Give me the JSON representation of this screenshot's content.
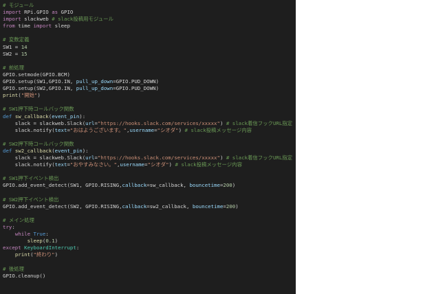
{
  "editor": {
    "background": "#1e1e1e",
    "language": "python",
    "lines": [
      [
        {
          "t": "# モジュール",
          "k": "cmt"
        }
      ],
      [
        {
          "t": "import",
          "k": "kw"
        },
        {
          "t": " RPi.GPIO ",
          "k": "txt"
        },
        {
          "t": "as",
          "k": "kw"
        },
        {
          "t": " GPIO",
          "k": "txt"
        }
      ],
      [
        {
          "t": "import",
          "k": "kw"
        },
        {
          "t": " slackweb ",
          "k": "txt"
        },
        {
          "t": "# slack投稿用モジュール",
          "k": "cmt"
        }
      ],
      [
        {
          "t": "from",
          "k": "kw"
        },
        {
          "t": " time ",
          "k": "txt"
        },
        {
          "t": "import",
          "k": "kw"
        },
        {
          "t": " sleep",
          "k": "txt"
        }
      ],
      [],
      [
        {
          "t": "# 変数定義",
          "k": "cmt"
        }
      ],
      [
        {
          "t": "SW1 = ",
          "k": "txt"
        },
        {
          "t": "14",
          "k": "num"
        }
      ],
      [
        {
          "t": "SW2 = ",
          "k": "txt"
        },
        {
          "t": "15",
          "k": "num"
        }
      ],
      [],
      [
        {
          "t": "# 前処理",
          "k": "cmt"
        }
      ],
      [
        {
          "t": "GPIO.setmode(GPIO.BCM)",
          "k": "txt"
        }
      ],
      [
        {
          "t": "GPIO.setup(SW1,GPIO.IN, ",
          "k": "txt"
        },
        {
          "t": "pull_up_down",
          "k": "var"
        },
        {
          "t": "=GPIO.PUD_DOWN)",
          "k": "txt"
        }
      ],
      [
        {
          "t": "GPIO.setup(SW2,GPIO.IN, ",
          "k": "txt"
        },
        {
          "t": "pull_up_down",
          "k": "var"
        },
        {
          "t": "=GPIO.PUD_DOWN)",
          "k": "txt"
        }
      ],
      [
        {
          "t": "print",
          "k": "fn"
        },
        {
          "t": "(",
          "k": "txt"
        },
        {
          "t": "\"開始\"",
          "k": "str"
        },
        {
          "t": ")",
          "k": "txt"
        }
      ],
      [],
      [
        {
          "t": "# SW1押下時コールバック関数",
          "k": "cmt"
        }
      ],
      [
        {
          "t": "def",
          "k": "def"
        },
        {
          "t": " ",
          "k": "txt"
        },
        {
          "t": "sw_callback",
          "k": "fn"
        },
        {
          "t": "(",
          "k": "txt"
        },
        {
          "t": "event_pin",
          "k": "var"
        },
        {
          "t": "):",
          "k": "txt"
        }
      ],
      [
        {
          "t": "    slack = slackweb.Slack(",
          "k": "txt"
        },
        {
          "t": "url",
          "k": "var"
        },
        {
          "t": "=",
          "k": "txt"
        },
        {
          "t": "\"https://hooks.slack.com/services/xxxxx\"",
          "k": "str"
        },
        {
          "t": ") ",
          "k": "txt"
        },
        {
          "t": "# slack着信フックURL指定",
          "k": "cmt"
        }
      ],
      [
        {
          "t": "    slack.notify(",
          "k": "txt"
        },
        {
          "t": "text",
          "k": "var"
        },
        {
          "t": "=",
          "k": "txt"
        },
        {
          "t": "\"おはようございます。\"",
          "k": "str"
        },
        {
          "t": ",",
          "k": "txt"
        },
        {
          "t": "username",
          "k": "var"
        },
        {
          "t": "=",
          "k": "txt"
        },
        {
          "t": "\"シオダ\"",
          "k": "str"
        },
        {
          "t": ") ",
          "k": "txt"
        },
        {
          "t": "# slack投稿メッセージ内容",
          "k": "cmt"
        }
      ],
      [],
      [
        {
          "t": "# SW2押下時コールバック関数",
          "k": "cmt"
        }
      ],
      [
        {
          "t": "def",
          "k": "def"
        },
        {
          "t": " ",
          "k": "txt"
        },
        {
          "t": "sw2_callback",
          "k": "fn"
        },
        {
          "t": "(",
          "k": "txt"
        },
        {
          "t": "event_pin",
          "k": "var"
        },
        {
          "t": "):",
          "k": "txt"
        }
      ],
      [
        {
          "t": "    slack = slackweb.Slack(",
          "k": "txt"
        },
        {
          "t": "url",
          "k": "var"
        },
        {
          "t": "=",
          "k": "txt"
        },
        {
          "t": "\"https://hooks.slack.com/services/xxxxx\"",
          "k": "str"
        },
        {
          "t": ") ",
          "k": "txt"
        },
        {
          "t": "# slack着信フックURL指定",
          "k": "cmt"
        }
      ],
      [
        {
          "t": "    slack.notify(",
          "k": "txt"
        },
        {
          "t": "text",
          "k": "var"
        },
        {
          "t": "=",
          "k": "txt"
        },
        {
          "t": "\"おやすみなさい。\"",
          "k": "str"
        },
        {
          "t": ",",
          "k": "txt"
        },
        {
          "t": "username",
          "k": "var"
        },
        {
          "t": "=",
          "k": "txt"
        },
        {
          "t": "\"シオダ\"",
          "k": "str"
        },
        {
          "t": ") ",
          "k": "txt"
        },
        {
          "t": "# slack投稿メッセージ内容",
          "k": "cmt"
        }
      ],
      [],
      [
        {
          "t": "# SW1押下イベント検出",
          "k": "cmt"
        }
      ],
      [
        {
          "t": "GPIO.add_event_detect(SW1, GPIO.RISING,",
          "k": "txt"
        },
        {
          "t": "callback",
          "k": "var"
        },
        {
          "t": "=sw_callback, ",
          "k": "txt"
        },
        {
          "t": "bouncetime",
          "k": "var"
        },
        {
          "t": "=",
          "k": "txt"
        },
        {
          "t": "200",
          "k": "num"
        },
        {
          "t": ")",
          "k": "txt"
        }
      ],
      [],
      [
        {
          "t": "# SW2押下イベント検出",
          "k": "cmt"
        }
      ],
      [
        {
          "t": "GPIO.add_event_detect(SW2, GPIO.RISING,",
          "k": "txt"
        },
        {
          "t": "callback",
          "k": "var"
        },
        {
          "t": "=sw2_callback, ",
          "k": "txt"
        },
        {
          "t": "bouncetime",
          "k": "var"
        },
        {
          "t": "=",
          "k": "txt"
        },
        {
          "t": "200",
          "k": "num"
        },
        {
          "t": ")",
          "k": "txt"
        }
      ],
      [],
      [
        {
          "t": "# メイン処理",
          "k": "cmt"
        }
      ],
      [
        {
          "t": "try",
          "k": "kw"
        },
        {
          "t": ":",
          "k": "txt"
        }
      ],
      [
        {
          "t": "    ",
          "k": "txt"
        },
        {
          "t": "while",
          "k": "kw"
        },
        {
          "t": " ",
          "k": "txt"
        },
        {
          "t": "True",
          "k": "def"
        },
        {
          "t": ":",
          "k": "txt"
        }
      ],
      [
        {
          "t": "        ",
          "k": "txt"
        },
        {
          "t": "sleep",
          "k": "fn"
        },
        {
          "t": "(",
          "k": "txt"
        },
        {
          "t": "0.1",
          "k": "num"
        },
        {
          "t": ")",
          "k": "txt"
        }
      ],
      [
        {
          "t": "except",
          "k": "kw"
        },
        {
          "t": " ",
          "k": "txt"
        },
        {
          "t": "KeyboardInterrupt",
          "k": "cls"
        },
        {
          "t": ":",
          "k": "txt"
        }
      ],
      [
        {
          "t": "    ",
          "k": "txt"
        },
        {
          "t": "print",
          "k": "fn"
        },
        {
          "t": "(",
          "k": "txt"
        },
        {
          "t": "\"終わり\"",
          "k": "str"
        },
        {
          "t": ")",
          "k": "txt"
        }
      ],
      [],
      [
        {
          "t": "# 後処理",
          "k": "cmt"
        }
      ],
      [
        {
          "t": "GPIO.cleanup()",
          "k": "txt"
        }
      ]
    ]
  },
  "theme_colors": {
    "comment": "#6a9955",
    "keyword": "#c586c0",
    "def_keyword": "#569cd6",
    "function": "#dcdcaa",
    "parameter": "#9cdcfe",
    "class": "#4ec9b0",
    "string": "#ce9178",
    "number": "#b5cea8",
    "text": "#d4d4d4"
  }
}
